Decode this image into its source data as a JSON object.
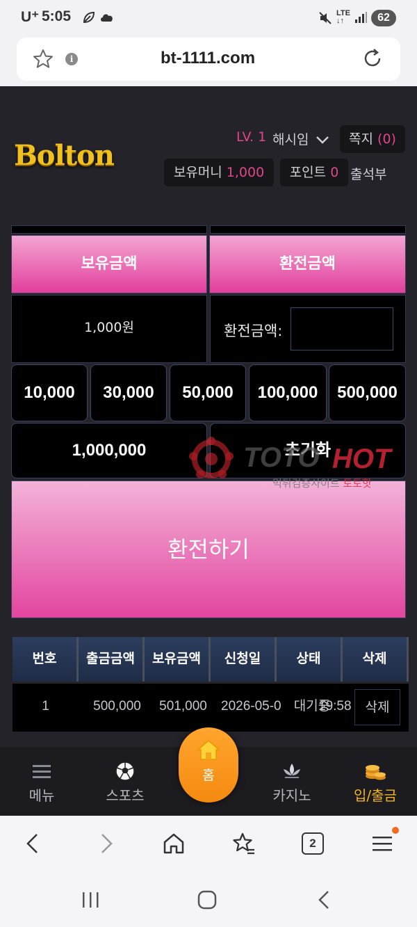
{
  "status_bar": {
    "carrier": "U⁺",
    "time": "5:05",
    "network": "LTE",
    "battery": "62"
  },
  "browser": {
    "url": "bt-1111.com",
    "tab_count": "2"
  },
  "header": {
    "logo": "Bolton",
    "level": "LV. 1",
    "username": "해시임",
    "messages_label": "쪽지",
    "messages_count": "(0)",
    "money_label": "보유머니",
    "money_value": "1,000",
    "point_label": "포인트",
    "point_value": "0",
    "attendance_label": "출석부"
  },
  "exchange": {
    "held_header": "보유금액",
    "exchange_header": "환전금액",
    "held_amount": "1,000원",
    "exchange_label": "환전금액:",
    "exchange_input_value": "",
    "quick_amounts": [
      "10,000",
      "30,000",
      "50,000",
      "100,000",
      "500,000"
    ],
    "quick_amount_large": "1,000,000",
    "reset_label": "초기화",
    "submit_label": "환전하기"
  },
  "watermark": {
    "brand_a": "TOTO",
    "brand_b": "HOT",
    "tagline_a": "먹튀검증사이트",
    "tagline_b": "토토핫"
  },
  "history_table": {
    "columns": [
      "번호",
      "출금금액",
      "보유금액",
      "신청일",
      "상태",
      "삭제"
    ],
    "rows": [
      {
        "no": "1",
        "withdraw_amount": "500,000",
        "balance": "501,000",
        "date": "2026-05-0",
        "time": "19:58",
        "status": "대기중",
        "delete_label": "삭제"
      }
    ]
  },
  "bottom_nav": {
    "menu": "메뉴",
    "sports": "스포츠",
    "home": "홈",
    "casino": "카지노",
    "deposit_withdraw": "입/출금"
  },
  "colors": {
    "accent_pink": "#e0468c",
    "gold": "#f0c020",
    "home_orange": "#f58a10"
  }
}
